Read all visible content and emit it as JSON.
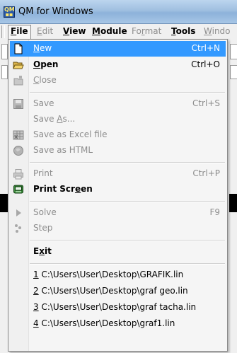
{
  "window": {
    "title": "QM for Windows",
    "app_icon": "qm-app-icon"
  },
  "menubar": {
    "items": [
      {
        "label": "File",
        "mnemonic": "F",
        "active": true,
        "enabled": true
      },
      {
        "label": "Edit",
        "mnemonic": "E",
        "enabled": false
      },
      {
        "label": "View",
        "mnemonic": "V",
        "enabled": true
      },
      {
        "label": "Module",
        "mnemonic": "M",
        "enabled": true
      },
      {
        "label": "Format",
        "mnemonic": "r",
        "enabled": false
      },
      {
        "label": "Tools",
        "mnemonic": "T",
        "enabled": true
      },
      {
        "label": "Windo",
        "mnemonic": "W",
        "enabled": false
      }
    ]
  },
  "file_menu": {
    "items": [
      {
        "label": "New",
        "mnemonic": "N",
        "shortcut": "Ctrl+N",
        "icon": "new-file-icon",
        "enabled": true,
        "highlighted": true
      },
      {
        "label": "Open",
        "mnemonic": "O",
        "shortcut": "Ctrl+O",
        "icon": "open-folder-icon",
        "enabled": true
      },
      {
        "label": "Close",
        "mnemonic": "C",
        "shortcut": "",
        "icon": "close-folder-icon",
        "enabled": false
      },
      {
        "label": "Save",
        "mnemonic": "",
        "shortcut": "Ctrl+S",
        "icon": "save-disk-icon",
        "enabled": false
      },
      {
        "label": "Save As...",
        "mnemonic": "A",
        "shortcut": "",
        "icon": "",
        "enabled": false
      },
      {
        "label": "Save as Excel file",
        "mnemonic": "",
        "shortcut": "",
        "icon": "excel-icon",
        "enabled": false
      },
      {
        "label": "Save as HTML",
        "mnemonic": "",
        "shortcut": "",
        "icon": "globe-icon",
        "enabled": false
      },
      {
        "label": "Print",
        "mnemonic": "",
        "shortcut": "Ctrl+P",
        "icon": "printer-icon",
        "enabled": false
      },
      {
        "label": "Print Screen",
        "mnemonic": "e",
        "shortcut": "",
        "icon": "print-screen-icon",
        "enabled": true
      },
      {
        "label": "Solve",
        "mnemonic": "",
        "shortcut": "F9",
        "icon": "play-icon",
        "enabled": false
      },
      {
        "label": "Step",
        "mnemonic": "",
        "shortcut": "",
        "icon": "step-icon",
        "enabled": false
      },
      {
        "label": "Exit",
        "mnemonic": "x",
        "shortcut": "",
        "icon": "",
        "enabled": true
      }
    ],
    "recent_files": [
      {
        "number": "1",
        "path": " C:\\Users\\User\\Desktop\\GRAFIK.lin"
      },
      {
        "number": "2",
        "path": " C:\\Users\\User\\Desktop\\graf geo.lin"
      },
      {
        "number": "3",
        "path": " C:\\Users\\User\\Desktop\\graf tacha.lin"
      },
      {
        "number": "4",
        "path": " C:\\Users\\User\\Desktop\\graf1.lin"
      }
    ]
  },
  "colors": {
    "highlight": "#3399ff",
    "disabled_text": "#8d8d8d",
    "menu_bg": "#f5f5f5"
  }
}
